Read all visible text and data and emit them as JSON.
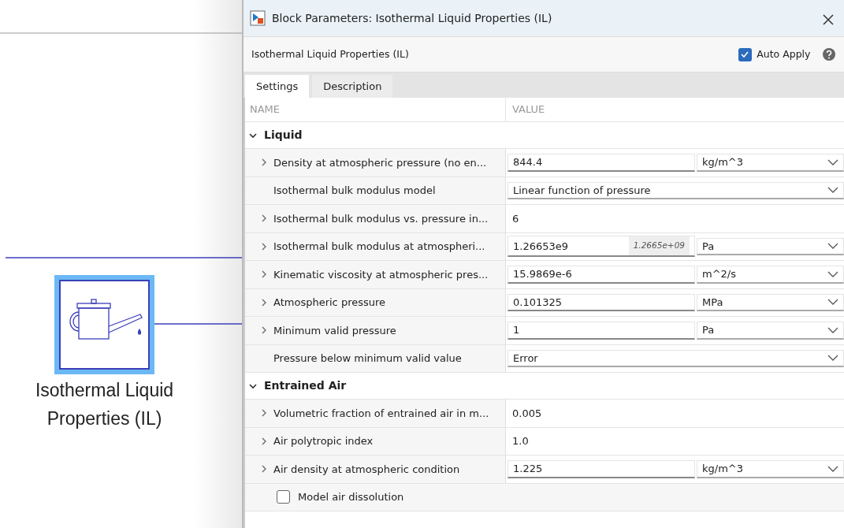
{
  "canvas": {
    "block": {
      "label": "Isothermal Liquid Properties (IL)",
      "selected": true
    }
  },
  "window": {
    "title": "Block Parameters: Isothermal Liquid Properties (IL)"
  },
  "header": {
    "block_name": "Isothermal Liquid Properties (IL)",
    "auto_apply": {
      "label": "Auto Apply",
      "checked": true
    }
  },
  "tabs": [
    {
      "label": "Settings",
      "selected": true
    },
    {
      "label": "Description",
      "selected": false
    }
  ],
  "table": {
    "columns": [
      "NAME",
      "VALUE"
    ],
    "sections": [
      {
        "title": "Liquid",
        "expanded": true,
        "params": [
          {
            "kind": "unit",
            "expandable": true,
            "name": "Density at atmospheric pressure (no en...",
            "value": "844.4",
            "unit": "kg/m^3"
          },
          {
            "kind": "dropdown",
            "expandable": false,
            "name": "Isothermal bulk modulus model",
            "value": "Linear function of pressure"
          },
          {
            "kind": "plain",
            "expandable": true,
            "name": "Isothermal bulk modulus vs. pressure in...",
            "value": "6"
          },
          {
            "kind": "unit",
            "expandable": true,
            "name": "Isothermal bulk modulus at atmospheri...",
            "value": "1.26653e9",
            "hint": "1.2665e+09",
            "unit": "Pa"
          },
          {
            "kind": "unit",
            "expandable": true,
            "name": "Kinematic viscosity at atmospheric pres...",
            "value": "15.9869e-6",
            "unit": "m^2/s"
          },
          {
            "kind": "unit",
            "expandable": true,
            "name": "Atmospheric pressure",
            "value": "0.101325",
            "unit": "MPa"
          },
          {
            "kind": "unit",
            "expandable": true,
            "name": "Minimum valid pressure",
            "value": "1",
            "unit": "Pa"
          },
          {
            "kind": "dropdown",
            "expandable": false,
            "name": "Pressure below minimum valid value",
            "value": "Error"
          }
        ]
      },
      {
        "title": "Entrained Air",
        "expanded": true,
        "params": [
          {
            "kind": "plain",
            "expandable": true,
            "name": "Volumetric fraction of entrained air in m...",
            "value": "0.005"
          },
          {
            "kind": "plain",
            "expandable": true,
            "name": "Air polytropic index",
            "value": "1.0"
          },
          {
            "kind": "unit",
            "expandable": true,
            "name": "Air density at atmospheric condition",
            "value": "1.225",
            "unit": "kg/m^3"
          },
          {
            "kind": "checkbox",
            "name": "Model air dissolution",
            "checked": false
          }
        ]
      }
    ]
  }
}
